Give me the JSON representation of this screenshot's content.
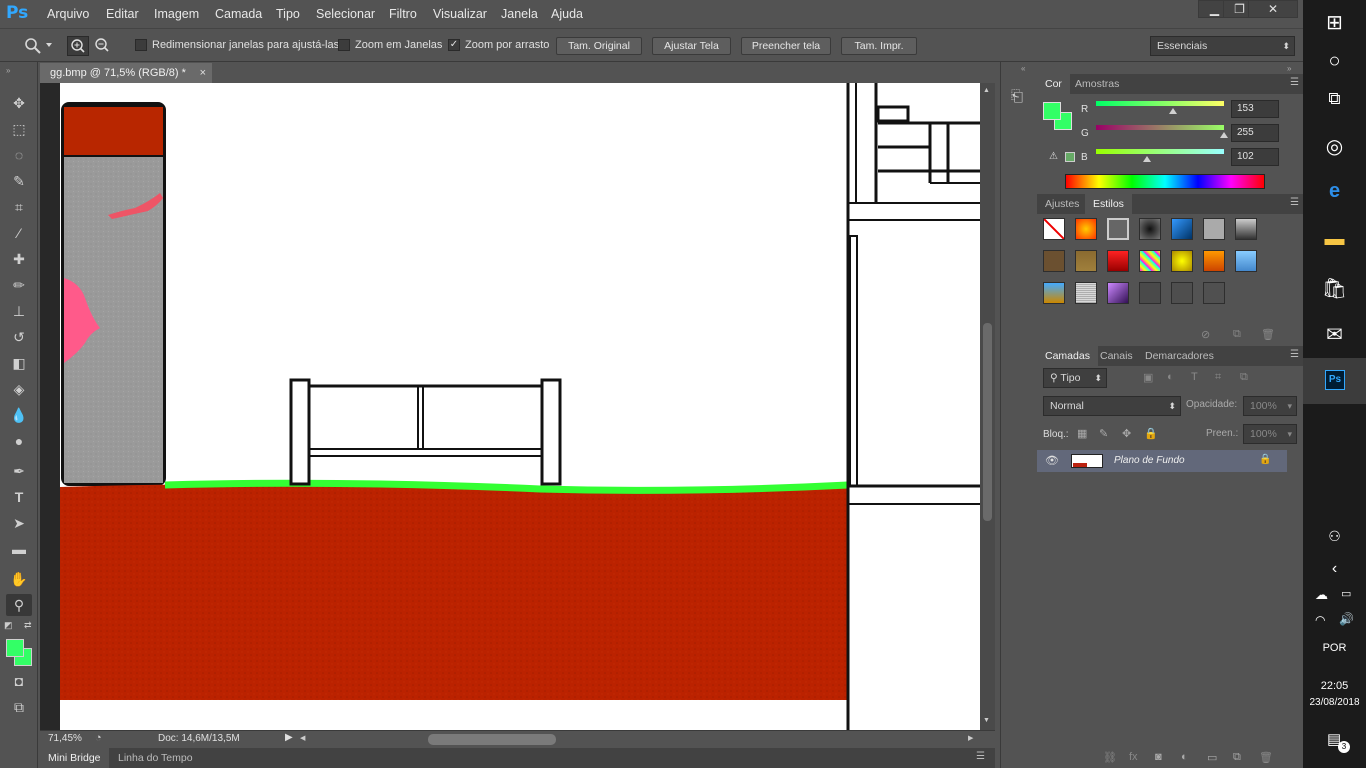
{
  "app": {
    "logo": "Ps"
  },
  "menu": [
    "Arquivo",
    "Editar",
    "Imagem",
    "Camada",
    "Tipo",
    "Selecionar",
    "Filtro",
    "Visualizar",
    "Janela",
    "Ajuda"
  ],
  "window_controls": {
    "minimize": "▁",
    "restore": "❐",
    "close": "✕"
  },
  "options": {
    "resize_windows_label": "Redimensionar janelas para ajustá-las",
    "zoom_all_label": "Zoom em Janelas",
    "scrubby_zoom_label": "Zoom por arrasto",
    "scrubby_checked": "✓",
    "buttons": [
      "Tam. Original",
      "Ajustar Tela",
      "Preencher tela",
      "Tam. Impr."
    ],
    "workspace": "Essenciais"
  },
  "document": {
    "tab_title": "gg.bmp @ 71,5% (RGB/8) *",
    "close": "×"
  },
  "status": {
    "zoom": "71,45%",
    "doc_size": "Doc: 14,6M/13,5M"
  },
  "bottom_tabs": [
    "Mini Bridge",
    "Linha do Tempo"
  ],
  "color_panel": {
    "tabs": [
      "Cor",
      "Amostras"
    ],
    "foreground": "#33ff66",
    "R": {
      "label": "R",
      "value": "153"
    },
    "G": {
      "label": "G",
      "value": "255"
    },
    "B": {
      "label": "B",
      "value": "102"
    }
  },
  "styles_panel": {
    "tabs": [
      "Ajustes",
      "Estilos"
    ]
  },
  "layers_panel": {
    "tabs": [
      "Camadas",
      "Canais",
      "Demarcadores"
    ],
    "filter_kind": "Tipo",
    "blend_mode": "Normal",
    "opacity_label": "Opacidade:",
    "opacity_value": "100%",
    "lock_label": "Bloq.:",
    "fill_label": "Preen.:",
    "fill_value": "100%",
    "layers": [
      {
        "name": "Plano de Fundo",
        "visible": true,
        "locked": true
      }
    ]
  },
  "taskbar": {
    "time": "22:05",
    "date": "23/08/2018",
    "language": "POR",
    "notifications": "3"
  },
  "colors": {
    "canvas_bg": "#ffffff",
    "ground_red": "#bb2200",
    "grass_green": "#33ff33",
    "accent_blue": "#31a8ff"
  }
}
